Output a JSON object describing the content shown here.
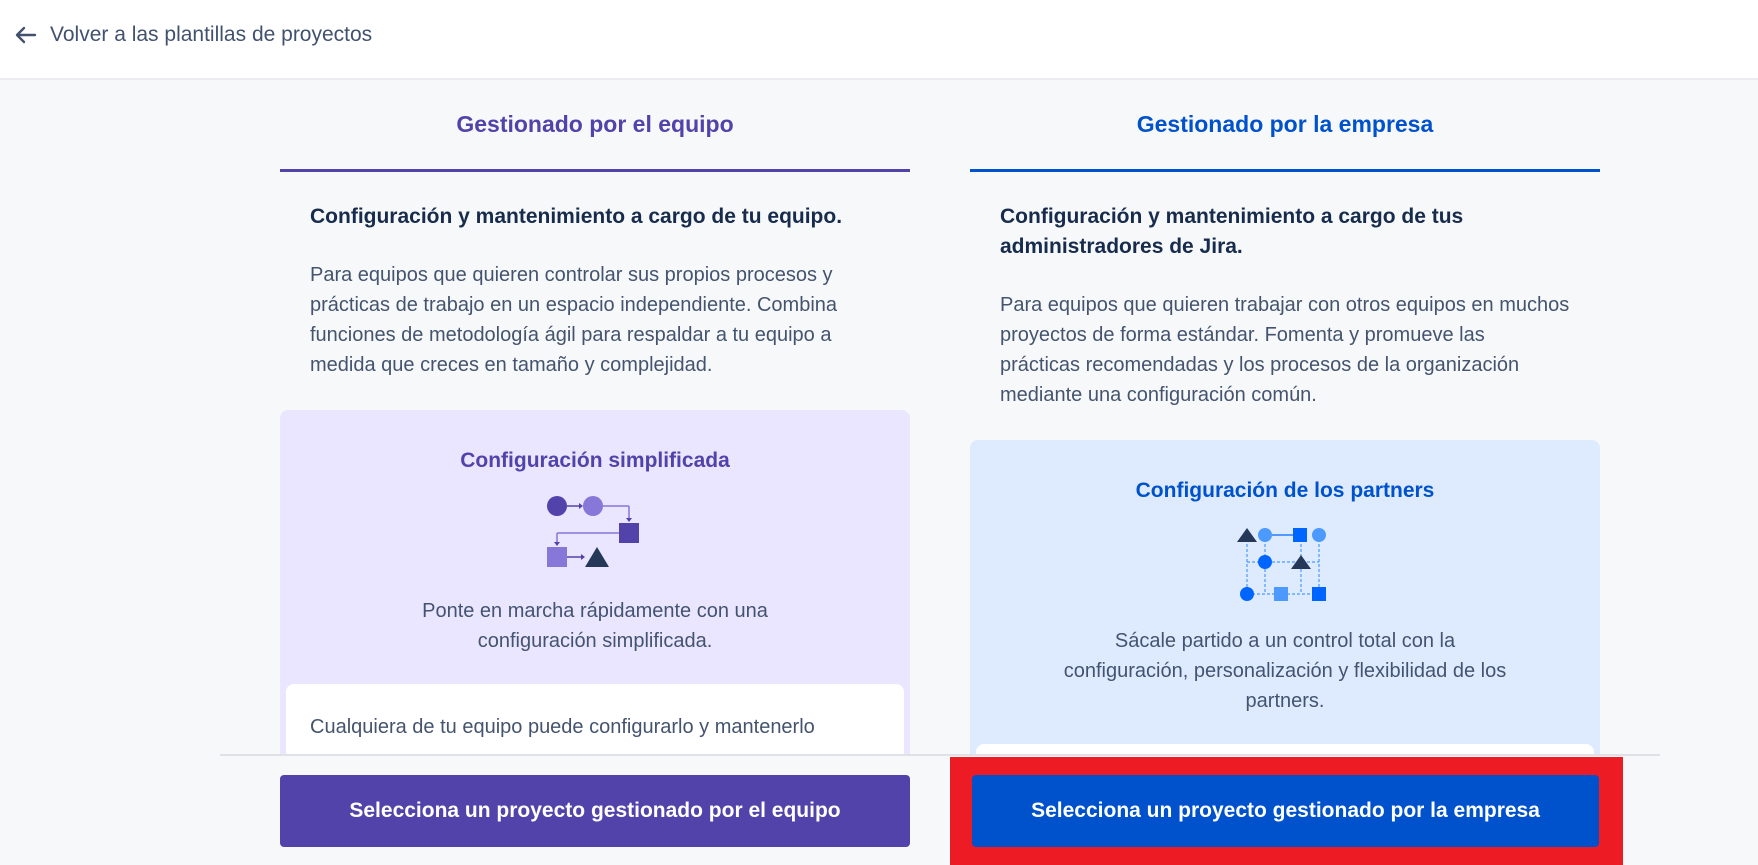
{
  "header": {
    "back_label": "Volver a las plantillas de proyectos",
    "back_icon": "arrow-left-icon"
  },
  "team": {
    "tab_label": "Gestionado por el equipo",
    "heading": "Configuración y mantenimiento a cargo de tu equipo.",
    "description": "Para equipos que quieren controlar sus propios procesos y prácticas de trabajo en un espacio independiente. Combina funciones de metodología ágil para respaldar a tu equipo a medida que creces en tamaño y complejidad.",
    "feature_title": "Configuración simplificada",
    "feature_icon": "simplified-config-illustration",
    "feature_text": "Ponte en marcha rápidamente con una configuración simplificada.",
    "inner_text": "Cualquiera de tu equipo puede configurarlo y mantenerlo",
    "button_label": "Selecciona un proyecto gestionado por el equipo",
    "accent_color": "#5243aa"
  },
  "company": {
    "tab_label": "Gestionado por la empresa",
    "heading": "Configuración y mantenimiento a cargo de tus administradores de Jira.",
    "description": "Para equipos que quieren trabajar con otros equipos en muchos proyectos de forma estándar. Fomenta y promueve las prácticas recomendadas y los procesos de la organización mediante una configuración común.",
    "feature_title": "Configuración de los partners",
    "feature_icon": "partner-config-illustration",
    "feature_text": "Sácale partido a un control total con la configuración, personalización y flexibilidad de los partners.",
    "button_label": "Selecciona un proyecto gestionado por la empresa",
    "accent_color": "#0052cc",
    "highlight_color": "#ed1c24"
  }
}
